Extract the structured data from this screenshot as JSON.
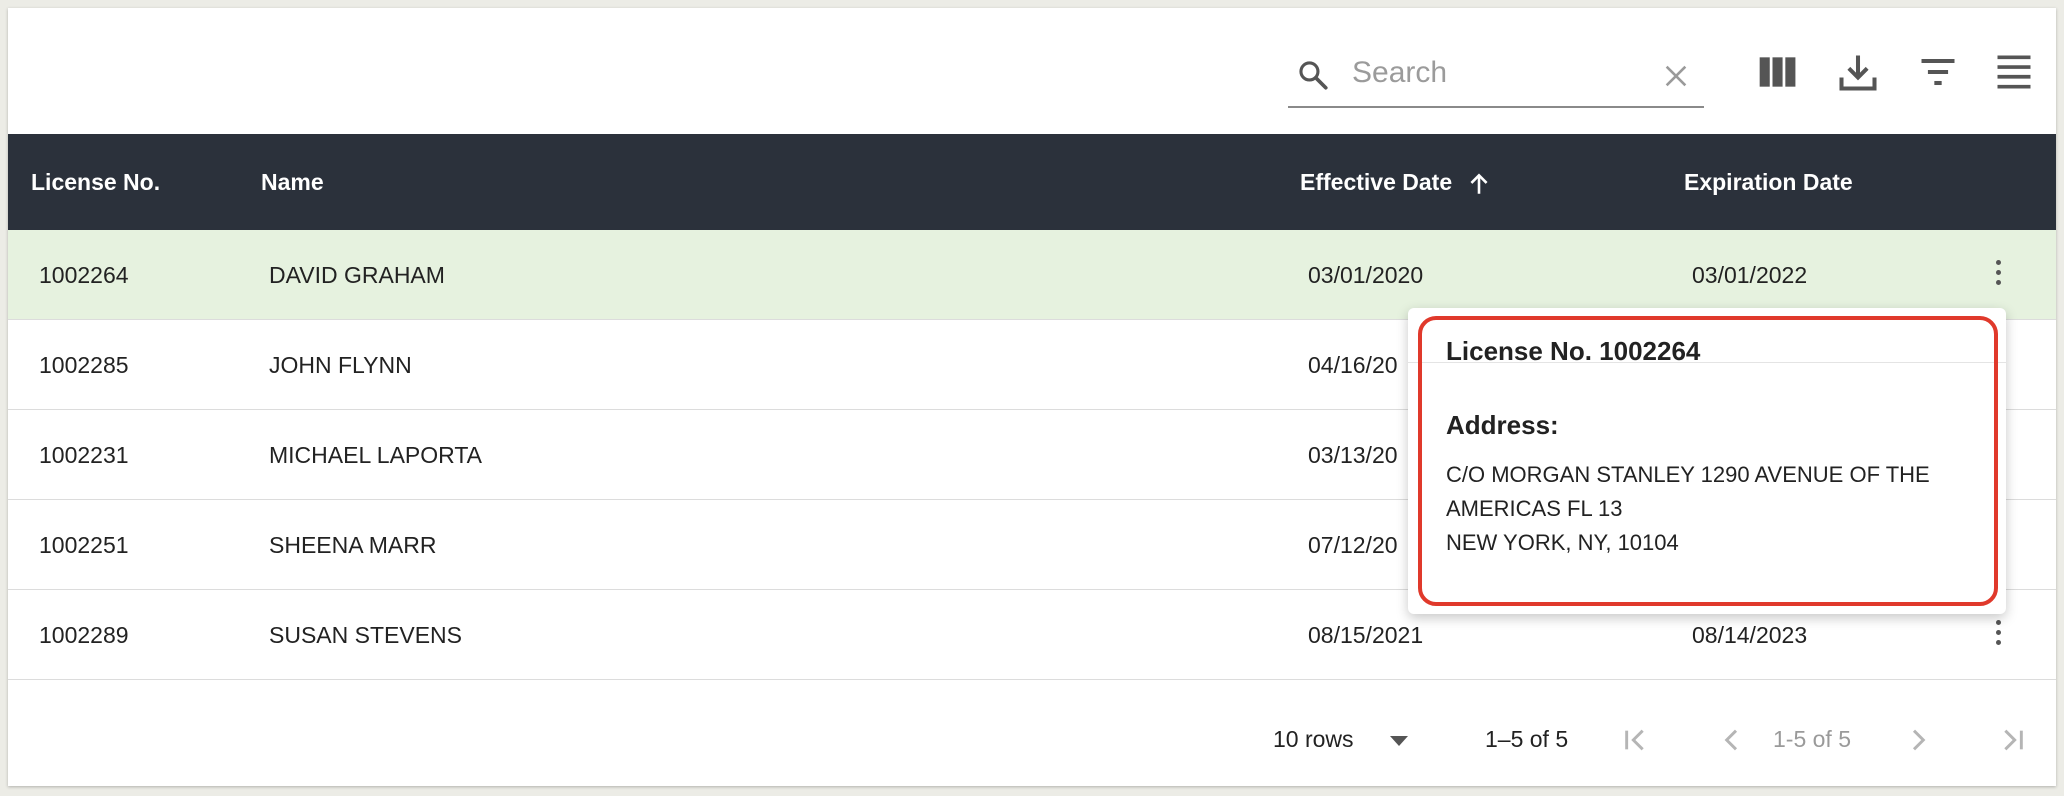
{
  "toolbar": {
    "search_placeholder": "Search",
    "icons": [
      "search-icon",
      "clear-icon",
      "columns-icon",
      "download-icon",
      "filter-icon",
      "density-icon"
    ]
  },
  "table": {
    "headers": {
      "license": "License No.",
      "name": "Name",
      "effective": "Effective Date",
      "expiration": "Expiration Date"
    },
    "sort": {
      "column": "Effective Date",
      "direction": "ascending"
    },
    "rows": [
      {
        "license": "1002264",
        "name": "DAVID GRAHAM",
        "effective": "03/01/2020",
        "expiration": "03/01/2022"
      },
      {
        "license": "1002285",
        "name": "JOHN FLYNN",
        "effective": "04/16/20",
        "expiration": ""
      },
      {
        "license": "1002231",
        "name": "MICHAEL LAPORTA",
        "effective": "03/13/20",
        "expiration": ""
      },
      {
        "license": "1002251",
        "name": "SHEENA MARR",
        "effective": "07/12/20",
        "expiration": ""
      },
      {
        "license": "1002289",
        "name": "SUSAN STEVENS",
        "effective": "08/15/2021",
        "expiration": "08/14/2023"
      }
    ],
    "selected_row_color": "#e6f2df",
    "header_color": "#2b313b"
  },
  "popover": {
    "title": "License No. 1002264",
    "address_label": "Address:",
    "address_lines": [
      "C/O MORGAN STANLEY 1290 AVENUE OF THE",
      "AMERICAS FL 13",
      "NEW YORK, NY, 10104"
    ],
    "highlight_color": "#e0392b"
  },
  "footer": {
    "rows_per_page": "10 rows",
    "range": "1–5 of 5",
    "page_label": "1-5 of 5"
  }
}
